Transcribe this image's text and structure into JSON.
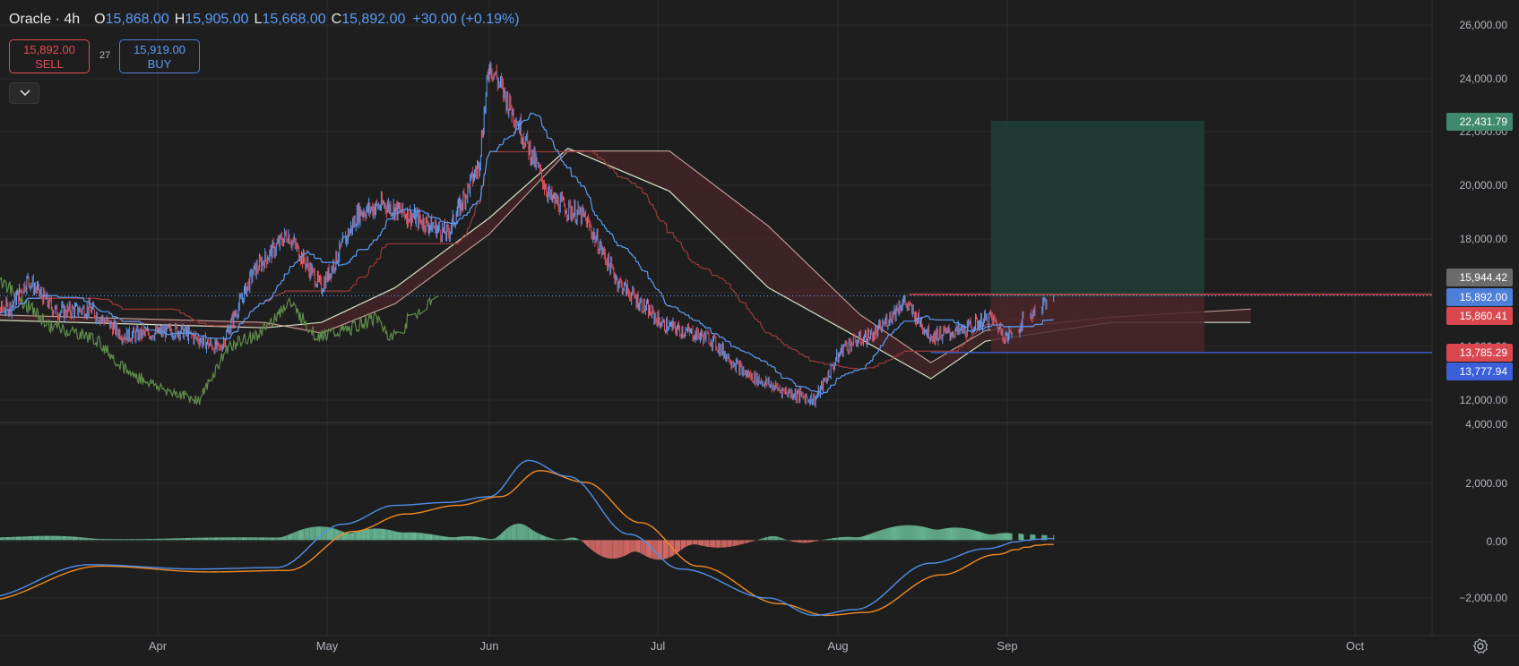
{
  "header": {
    "title": "Oracle · 4h",
    "o_label": "O",
    "o_value": "15,868.00",
    "h_label": "H",
    "h_value": "15,905.00",
    "l_label": "L",
    "l_value": "15,668.00",
    "c_label": "C",
    "c_value": "15,892.00",
    "change": "+30.00 (+0.19%)"
  },
  "trade": {
    "sell_price": "15,892.00",
    "sell_label": "SELL",
    "spread": "27",
    "buy_price": "15,919.00",
    "buy_label": "BUY"
  },
  "icons": {
    "collapse": "chevron-down-icon",
    "settings": "gear-icon"
  },
  "colors": {
    "background": "#1e1e1e",
    "up": "#5b9cf6",
    "down": "#e04c54",
    "profit_zone": "#1f3f37",
    "loss_zone": "#4a2629",
    "macd": "#4f8fe8",
    "signal": "#f08a24",
    "hist_pos": "#6fc59f",
    "hist_neg": "#e8736e"
  },
  "chart_data": [
    {
      "type": "candlestick",
      "title": "Oracle · 4h",
      "x_ticks": [
        "Apr",
        "May",
        "Jun",
        "Jul",
        "Aug",
        "Sep",
        "Oct"
      ],
      "y_ticks": [
        "12,000.00",
        "14,000.00",
        "16,000.00",
        "18,000.00",
        "20,000.00",
        "22,000.00",
        "24,000.00",
        "26,000.00"
      ],
      "ylim": [
        11300,
        26500
      ],
      "grid": true,
      "price_keypoints": [
        {
          "date": "2025-03-01",
          "price": 15200
        },
        {
          "date": "2025-03-06",
          "price": 15500
        },
        {
          "date": "2025-03-09",
          "price": 16500
        },
        {
          "date": "2025-03-14",
          "price": 15300
        },
        {
          "date": "2025-03-20",
          "price": 15400
        },
        {
          "date": "2025-03-26",
          "price": 14400
        },
        {
          "date": "2025-04-05",
          "price": 14600
        },
        {
          "date": "2025-04-12",
          "price": 13900
        },
        {
          "date": "2025-04-18",
          "price": 16800
        },
        {
          "date": "2025-04-24",
          "price": 18200
        },
        {
          "date": "2025-04-30",
          "price": 16200
        },
        {
          "date": "2025-05-07",
          "price": 19000
        },
        {
          "date": "2025-05-12",
          "price": 19300
        },
        {
          "date": "2025-05-19",
          "price": 18700
        },
        {
          "date": "2025-05-24",
          "price": 18200
        },
        {
          "date": "2025-05-30",
          "price": 20800
        },
        {
          "date": "2025-06-01",
          "price": 24600
        },
        {
          "date": "2025-06-06",
          "price": 22400
        },
        {
          "date": "2025-06-12",
          "price": 19500
        },
        {
          "date": "2025-06-18",
          "price": 18800
        },
        {
          "date": "2025-06-24",
          "price": 16400
        },
        {
          "date": "2025-07-02",
          "price": 14800
        },
        {
          "date": "2025-07-10",
          "price": 14300
        },
        {
          "date": "2025-07-16",
          "price": 13000
        },
        {
          "date": "2025-07-22",
          "price": 12400
        },
        {
          "date": "2025-07-28",
          "price": 12000
        },
        {
          "date": "2025-08-02",
          "price": 14000
        },
        {
          "date": "2025-08-08",
          "price": 14500
        },
        {
          "date": "2025-08-13",
          "price": 15700
        },
        {
          "date": "2025-08-18",
          "price": 14400
        },
        {
          "date": "2025-08-24",
          "price": 14600
        },
        {
          "date": "2025-08-29",
          "price": 15100
        },
        {
          "date": "2025-09-01",
          "price": 14300
        },
        {
          "date": "2025-09-05",
          "price": 15892
        }
      ],
      "last_ohlc": {
        "open": 15868,
        "high": 15905,
        "low": 15668,
        "close": 15892
      },
      "ichimoku": {
        "conversion_color": "#5b9cf6",
        "base_color": "#9c3a3a",
        "lagging_color": "#5e8c4a",
        "span_a": [
          {
            "date": "2025-03-01",
            "price": 15000
          },
          {
            "date": "2025-04-20",
            "price": 14700
          },
          {
            "date": "2025-04-30",
            "price": 14900
          },
          {
            "date": "2025-05-14",
            "price": 16200
          },
          {
            "date": "2025-06-01",
            "price": 18800
          },
          {
            "date": "2025-06-15",
            "price": 21400
          },
          {
            "date": "2025-07-03",
            "price": 19800
          },
          {
            "date": "2025-07-20",
            "price": 16200
          },
          {
            "date": "2025-08-05",
            "price": 14300
          },
          {
            "date": "2025-08-18",
            "price": 12800
          },
          {
            "date": "2025-08-28",
            "price": 14200
          },
          {
            "date": "2025-09-10",
            "price": 14900
          },
          {
            "date": "2025-09-22",
            "price": 14900
          }
        ],
        "span_b": [
          {
            "date": "2025-03-01",
            "price": 15200
          },
          {
            "date": "2025-04-20",
            "price": 14900
          },
          {
            "date": "2025-04-30",
            "price": 14500
          },
          {
            "date": "2025-05-14",
            "price": 15600
          },
          {
            "date": "2025-06-01",
            "price": 18200
          },
          {
            "date": "2025-06-15",
            "price": 21300
          },
          {
            "date": "2025-07-03",
            "price": 21300
          },
          {
            "date": "2025-07-20",
            "price": 18500
          },
          {
            "date": "2025-08-05",
            "price": 15200
          },
          {
            "date": "2025-08-18",
            "price": 13400
          },
          {
            "date": "2025-08-28",
            "price": 14600
          },
          {
            "date": "2025-09-10",
            "price": 15100
          },
          {
            "date": "2025-09-22",
            "price": 15400
          }
        ]
      },
      "price_labels": [
        {
          "value": "22,431.79",
          "price": 22431.79,
          "color": "#3f8a6e"
        },
        {
          "value": "15,944.42",
          "price": 15944.42,
          "color": "#6b6b6b"
        },
        {
          "value": "15,892.00",
          "price": 15892.0,
          "color": "#4e7fd8"
        },
        {
          "value": "15,860.41",
          "price": 15860.41,
          "color": "#d9474f"
        },
        {
          "value": "13,785.29",
          "price": 13785.29,
          "color": "#d9474f"
        },
        {
          "value": "13,777.94",
          "price": 13777.94,
          "color": "#3a5fd8"
        }
      ],
      "position": {
        "type": "long",
        "entry": 15860.41,
        "target": 22431.79,
        "stop": 13785.29,
        "start": "2025-08-29",
        "end": "2025-09-18"
      },
      "horizontal_lines": [
        {
          "price": 15944.42,
          "from": "2025-08-14",
          "color": "#e04c54"
        },
        {
          "price": 13777.94,
          "from": "2025-08-18",
          "color": "#3a5fd8"
        }
      ]
    },
    {
      "type": "macd",
      "y_ticks": [
        "4,000.00",
        "2,000.00",
        "0.00",
        "−2,000.00"
      ],
      "ylim": [
        -2700,
        4200
      ],
      "macd": [
        {
          "date": "2025-03-01",
          "value": -2000
        },
        {
          "date": "2025-03-20",
          "value": -850
        },
        {
          "date": "2025-04-08",
          "value": -1000
        },
        {
          "date": "2025-04-22",
          "value": -950
        },
        {
          "date": "2025-05-04",
          "value": 550
        },
        {
          "date": "2025-05-14",
          "value": 1200
        },
        {
          "date": "2025-05-24",
          "value": 1300
        },
        {
          "date": "2025-06-01",
          "value": 1500
        },
        {
          "date": "2025-06-08",
          "value": 2750
        },
        {
          "date": "2025-06-15",
          "value": 2200
        },
        {
          "date": "2025-06-26",
          "value": 200
        },
        {
          "date": "2025-07-05",
          "value": -1000
        },
        {
          "date": "2025-07-20",
          "value": -2000
        },
        {
          "date": "2025-07-28",
          "value": -2600
        },
        {
          "date": "2025-08-04",
          "value": -2400
        },
        {
          "date": "2025-08-18",
          "value": -800
        },
        {
          "date": "2025-08-28",
          "value": -300
        },
        {
          "date": "2025-09-05",
          "value": 50
        }
      ],
      "signal": [
        {
          "date": "2025-03-01",
          "value": -2100
        },
        {
          "date": "2025-03-22",
          "value": -900
        },
        {
          "date": "2025-04-10",
          "value": -1100
        },
        {
          "date": "2025-04-24",
          "value": -1050
        },
        {
          "date": "2025-05-06",
          "value": 300
        },
        {
          "date": "2025-05-16",
          "value": 900
        },
        {
          "date": "2025-05-26",
          "value": 1200
        },
        {
          "date": "2025-06-03",
          "value": 1500
        },
        {
          "date": "2025-06-10",
          "value": 2400
        },
        {
          "date": "2025-06-18",
          "value": 2000
        },
        {
          "date": "2025-06-28",
          "value": 600
        },
        {
          "date": "2025-07-08",
          "value": -900
        },
        {
          "date": "2025-07-22",
          "value": -2200
        },
        {
          "date": "2025-07-30",
          "value": -2600
        },
        {
          "date": "2025-08-06",
          "value": -2500
        },
        {
          "date": "2025-08-20",
          "value": -1200
        },
        {
          "date": "2025-08-30",
          "value": -500
        },
        {
          "date": "2025-09-05",
          "value": -150
        }
      ]
    }
  ]
}
